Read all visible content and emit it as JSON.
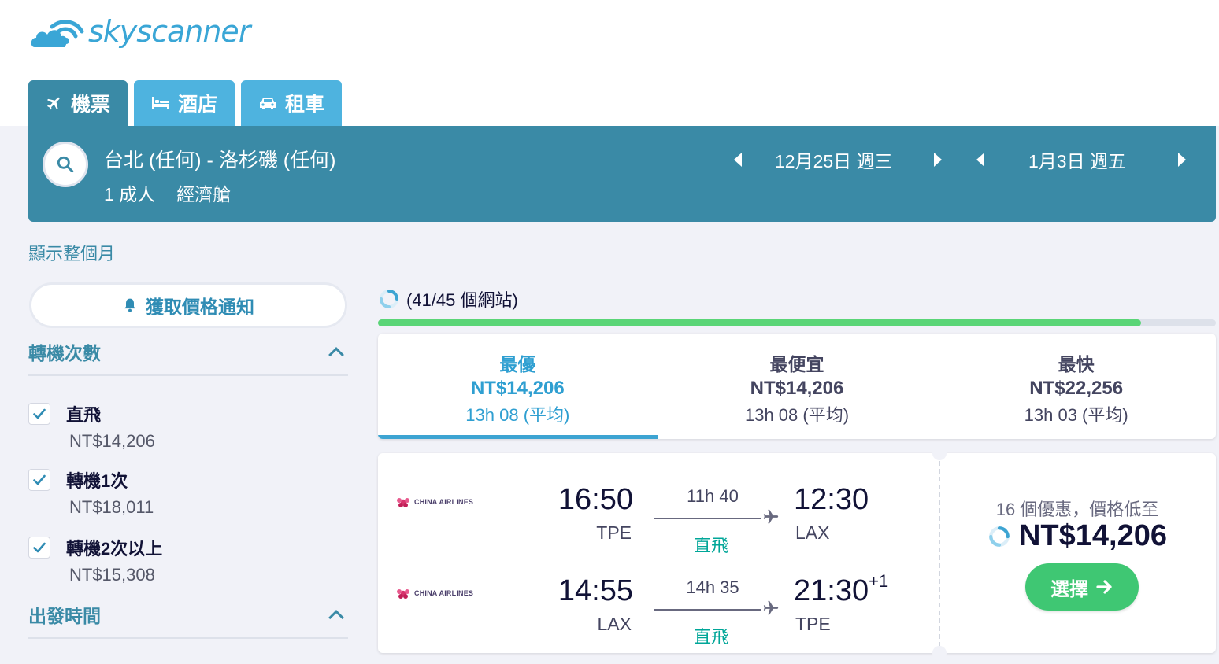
{
  "app": {
    "logo_text": "skyscanner"
  },
  "tabs": [
    {
      "label": "機票",
      "icon": "plane-icon",
      "active": true
    },
    {
      "label": "酒店",
      "icon": "bed-icon",
      "active": false
    },
    {
      "label": "租車",
      "icon": "car-icon",
      "active": false
    }
  ],
  "search": {
    "route": "台北 (任何) - 洛杉磯 (任何)",
    "passengers": "1 成人",
    "cabin": "經濟艙",
    "depart_date": "12月25日 週三",
    "return_date": "1月3日 週五"
  },
  "sidebar": {
    "show_month": "顯示整個月",
    "price_alert": "獲取價格通知",
    "stops_title": "轉機次數",
    "stops": [
      {
        "label": "直飛",
        "price": "NT$14,206",
        "checked": true
      },
      {
        "label": "轉機1次",
        "price": "NT$18,011",
        "checked": true
      },
      {
        "label": "轉機2次以上",
        "price": "NT$15,308",
        "checked": true
      }
    ],
    "departure_title": "出發時間"
  },
  "progress": {
    "text": "(41/45 個網站)",
    "done": 41,
    "total": 45
  },
  "sort_tabs": [
    {
      "title": "最優",
      "price": "NT$14,206",
      "duration": "13h 08 (平均)",
      "active": true
    },
    {
      "title": "最便宜",
      "price": "NT$14,206",
      "duration": "13h 08 (平均)",
      "active": false
    },
    {
      "title": "最快",
      "price": "NT$22,256",
      "duration": "13h 03 (平均)",
      "active": false
    }
  ],
  "result": {
    "airline": "CHINA AIRLINES",
    "outbound": {
      "dep_time": "16:50",
      "dep_code": "TPE",
      "duration": "11h 40",
      "stops": "直飛",
      "arr_time": "12:30",
      "arr_code": "LAX",
      "day_offset": ""
    },
    "inbound": {
      "dep_time": "14:55",
      "dep_code": "LAX",
      "duration": "14h 35",
      "stops": "直飛",
      "arr_time": "21:30",
      "arr_code": "TPE",
      "day_offset": "+1"
    },
    "deals_text": "16 個優惠，價格低至",
    "price": "NT$14,206",
    "select_label": "選擇"
  },
  "colors": {
    "brand_teal": "#3a8aa6",
    "tab_blue": "#4eb3df",
    "progress_green": "#5ad577",
    "select_green": "#3fc773",
    "direct_teal": "#00a698"
  }
}
